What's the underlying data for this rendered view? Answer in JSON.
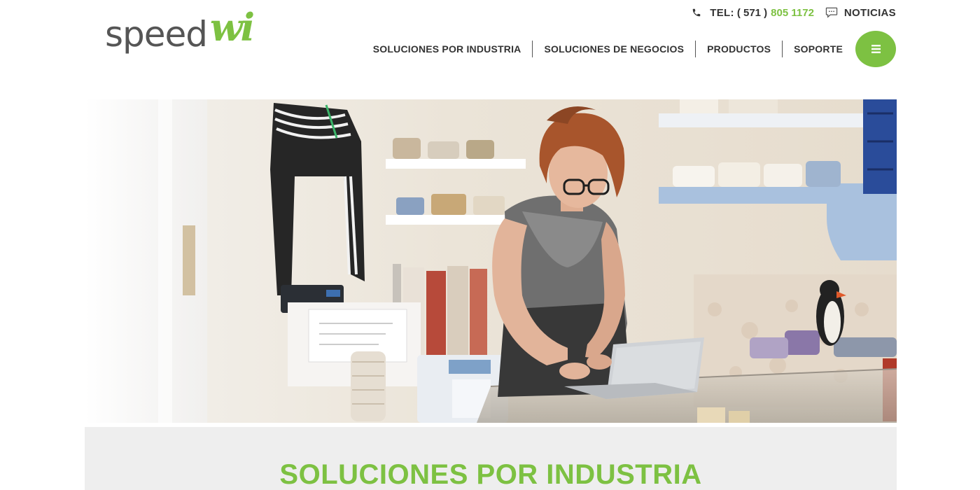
{
  "brand": {
    "logo_word": "speed",
    "logo_accent": "wi",
    "accent_color": "#7dc142",
    "text_color": "#555555"
  },
  "topbar": {
    "phone_icon": "phone-icon",
    "tel_label": "TEL:",
    "tel_prefix": "( 571 )",
    "tel_number": "805 1172",
    "news_icon": "chat-bubble-icon",
    "news_label": "NOTICIAS"
  },
  "nav": {
    "items": [
      {
        "label": "SOLUCIONES POR INDUSTRIA"
      },
      {
        "label": "SOLUCIONES DE NEGOCIOS"
      },
      {
        "label": "PRODUCTOS"
      },
      {
        "label": "SOPORTE"
      }
    ],
    "menu_icon": "hamburger-menu-icon"
  },
  "hero": {
    "image": "woman-using-laptop-in-clothing-shop"
  },
  "section": {
    "title": "SOLUCIONES POR INDUSTRIA",
    "background": "#eeeeee"
  }
}
